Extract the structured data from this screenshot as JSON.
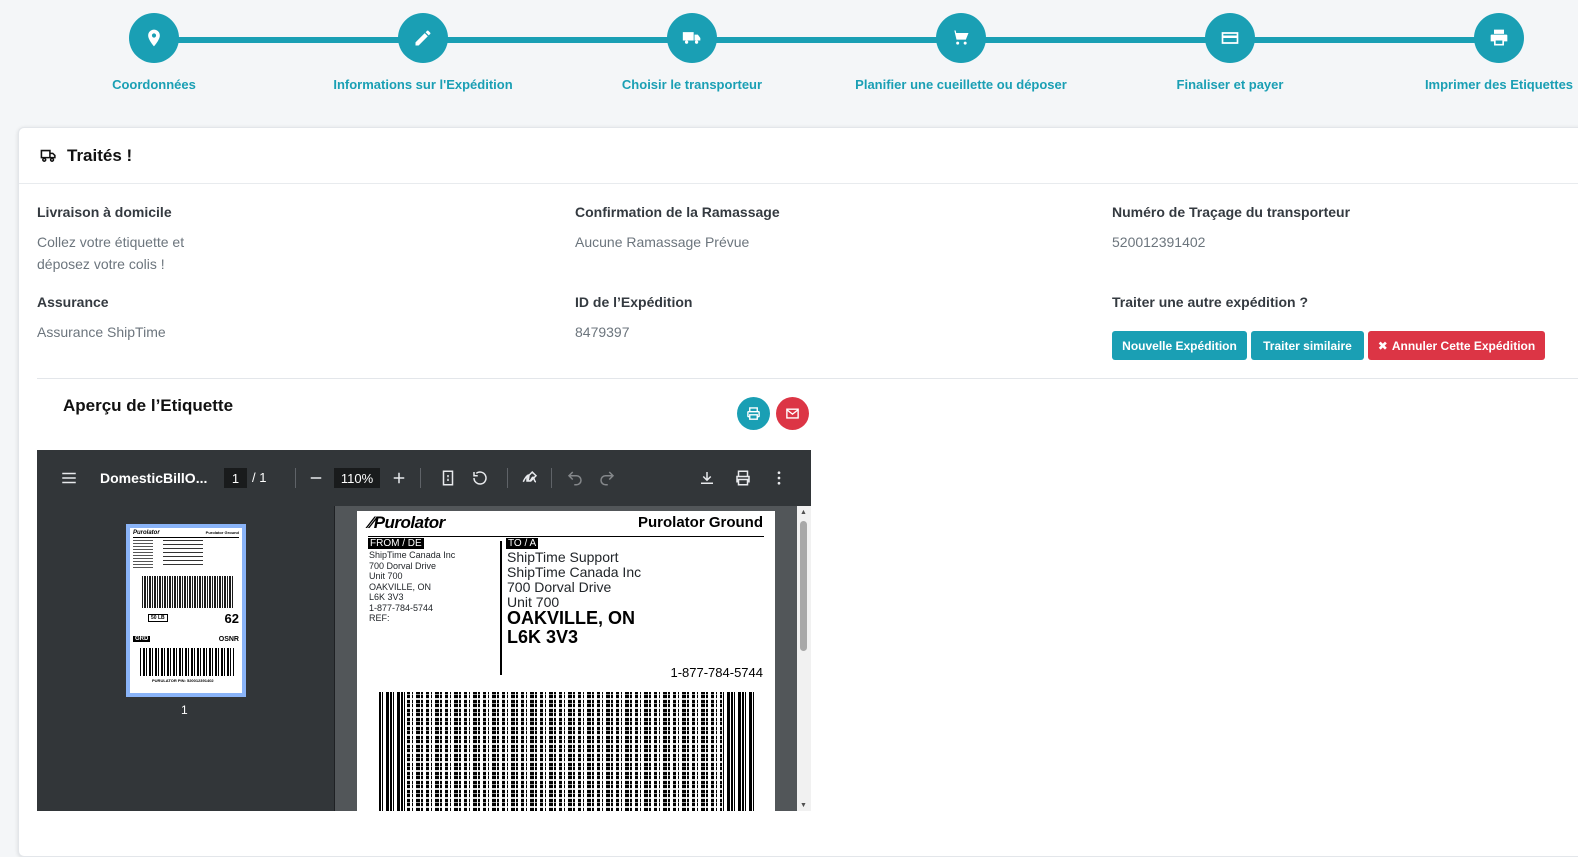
{
  "stepper": {
    "steps": [
      {
        "label": "Coordonnées",
        "icon": "map-marker-icon"
      },
      {
        "label": "Informations sur l'Expédition",
        "icon": "pencil-icon"
      },
      {
        "label": "Choisir le transporteur",
        "icon": "truck-icon"
      },
      {
        "label": "Planifier une cueillette ou déposer",
        "icon": "cart-icon"
      },
      {
        "label": "Finaliser et payer",
        "icon": "credit-card-icon"
      },
      {
        "label": "Imprimer des Etiquettes",
        "icon": "printer-icon"
      }
    ]
  },
  "card": {
    "title": "Traités !",
    "fields": {
      "delivery": {
        "label": "Livraison à domicile",
        "value_line1": "Collez votre étiquette et",
        "value_line2": "déposez votre colis !"
      },
      "pickup": {
        "label": "Confirmation de la Ramassage",
        "value": "Aucune Ramassage Prévue"
      },
      "tracking": {
        "label": "Numéro de Traçage du transporteur",
        "value": "520012391402"
      },
      "insurance": {
        "label": "Assurance",
        "value": "Assurance ShipTime"
      },
      "shipment_id": {
        "label": "ID de l’Expédition",
        "value": "8479397"
      },
      "another": {
        "label": "Traiter une autre expédition ?"
      }
    },
    "buttons": {
      "new_shipment": "Nouvelle Expédition",
      "similar": "Traiter similaire",
      "cancel": "Annuler Cette Expédition"
    },
    "preview_title": "Aperçu de l’Etiquette"
  },
  "viewer": {
    "filename": "DomesticBillO...",
    "current_page": "1",
    "page_of": "/  1",
    "zoom": "110%",
    "thumb_page": "1"
  },
  "label": {
    "carrier_logo": "Purolator",
    "service": "Purolator Ground",
    "from_tag": "FROM / DE",
    "from_lines": [
      "ShipTime Canada Inc",
      "700 Dorval Drive",
      "Unit 700",
      "OAKVILLE, ON",
      "L6K 3V3",
      "1-877-784-5744",
      "REF:"
    ],
    "to_tag": "TO / A",
    "to_lines": [
      "ShipTime Support",
      "ShipTime Canada Inc",
      "700 Dorval Drive",
      "Unit 700"
    ],
    "to_city": "OAKVILLE, ON",
    "to_postal": "L6K 3V3",
    "to_phone": "1-877-784-5744",
    "thumb_weight": "50 LB",
    "thumb_number": "62",
    "thumb_service": "GRD",
    "thumb_code": "OSNR",
    "thumb_pin": "PURULATOR PIN: 520012391402"
  },
  "colors": {
    "accent": "#1a9fb4",
    "danger": "#dc3545"
  }
}
